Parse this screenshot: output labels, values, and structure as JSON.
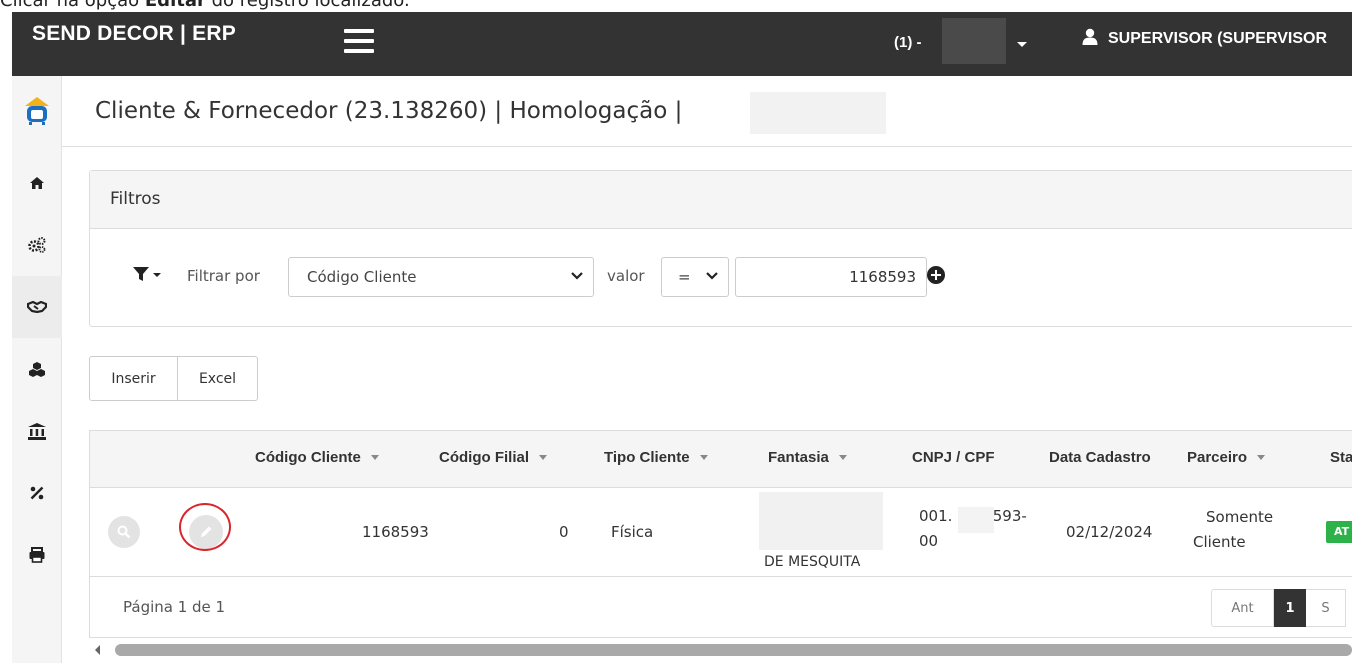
{
  "caption": {
    "prefix": "Clicar na opção ",
    "strong": "Editar",
    "suffix": " do registro localizado."
  },
  "topbar": {
    "brand": "SEND DECOR | ERP",
    "company_label": "(1) -",
    "user": "SUPERVISOR (SUPERVISOR"
  },
  "sidebar": {
    "items": [
      {
        "icon": "logo-icon"
      },
      {
        "icon": "home-icon"
      },
      {
        "icon": "cogs-icon"
      },
      {
        "icon": "handshake-icon"
      },
      {
        "icon": "cubes-icon"
      },
      {
        "icon": "bank-icon"
      },
      {
        "icon": "percent-icon"
      },
      {
        "icon": "print-icon"
      }
    ],
    "active_index": 3
  },
  "page": {
    "title": "Cliente & Fornecedor (23.138260) | Homologação |"
  },
  "filters": {
    "heading": "Filtros",
    "filter_by_label": "Filtrar por",
    "field_value": "Código Cliente",
    "valor_label": "valor",
    "operator_value": "=",
    "input_value": "1168593"
  },
  "actions": {
    "insert_label": "Inserir",
    "excel_label": "Excel"
  },
  "grid": {
    "columns": [
      "Código Cliente",
      "Código Filial",
      "Tipo Cliente",
      "Fantasia",
      "CNPJ / CPF",
      "Data Cadastro",
      "Parceiro",
      "Stat"
    ],
    "row": {
      "codigo_cliente": "1168593",
      "codigo_filial": "0",
      "tipo_cliente": "Física",
      "fantasia": "DE MESQUITA",
      "cnpj_line1": "001.",
      "cnpj_mid": ".593-",
      "cnpj_line2": "00",
      "data_cadastro": "02/12/2024",
      "parceiro_line1": "Somente",
      "parceiro_line2": "Cliente",
      "status": "AT"
    },
    "footer": {
      "page_info": "Página 1 de 1",
      "prev": "Ant",
      "current": "1",
      "next": "S"
    }
  },
  "colors": {
    "topbar": "#333333",
    "highlight_ring": "#d9262c",
    "status_active": "#2db24a",
    "logo_blue": "#1a6fc0",
    "logo_gold": "#f2b21b"
  }
}
